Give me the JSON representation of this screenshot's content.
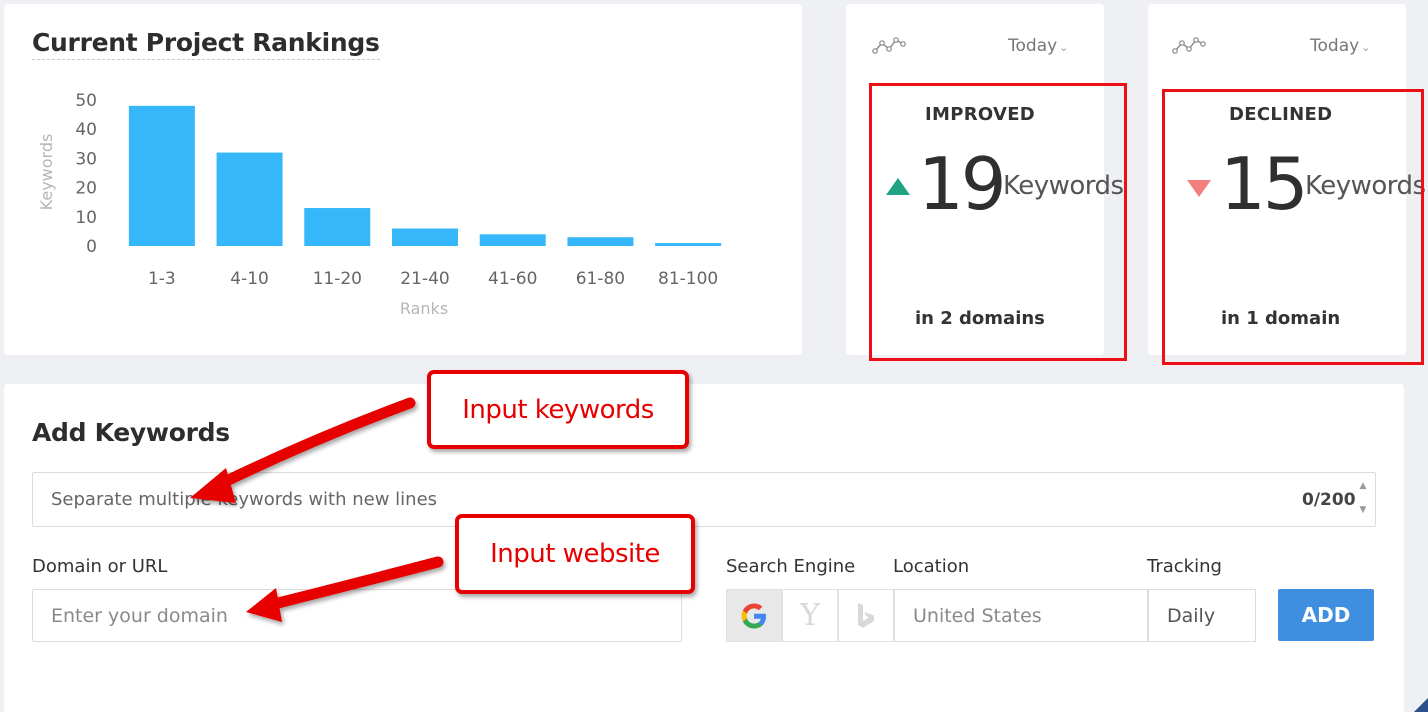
{
  "rankings": {
    "title": "Current Project Rankings"
  },
  "chart_data": {
    "type": "bar",
    "title": "",
    "categories": [
      "1-3",
      "4-10",
      "11-20",
      "21-40",
      "41-60",
      "61-80",
      "81-100"
    ],
    "values": [
      48,
      32,
      13,
      6,
      4,
      3,
      1
    ],
    "xlabel": "Ranks",
    "ylabel": "Keywords",
    "ylim": [
      0,
      50
    ],
    "yticks": [
      0,
      10,
      20,
      30,
      40,
      50
    ],
    "grid": false,
    "color": "#35b7fa"
  },
  "improved": {
    "period": "Today",
    "label": "IMPROVED",
    "count": "19",
    "unit": "Keywords",
    "domains": "in 2 domains",
    "color": "#1ea385"
  },
  "declined": {
    "period": "Today",
    "label": "DECLINED",
    "count": "15",
    "unit": "Keywords",
    "domains": "in 1 domain",
    "color": "#f47e7e"
  },
  "add_keywords": {
    "title": "Add Keywords",
    "keywords_placeholder": "Separate multiple keywords with new lines",
    "counter": "0/200",
    "domain_label": "Domain or URL",
    "domain_placeholder": "Enter your domain",
    "search_engine_label": "Search Engine",
    "engines": [
      "google-icon",
      "yahoo-icon",
      "bing-icon"
    ],
    "location_label": "Location",
    "location_placeholder": "United States",
    "tracking_label": "Tracking",
    "tracking_value": "Daily",
    "add_button": "ADD",
    "accent": "#3f8fe0"
  },
  "annotations": {
    "keywords_callout": "Input keywords",
    "website_callout": "Input website",
    "highlight_color": "#ec0f16"
  }
}
